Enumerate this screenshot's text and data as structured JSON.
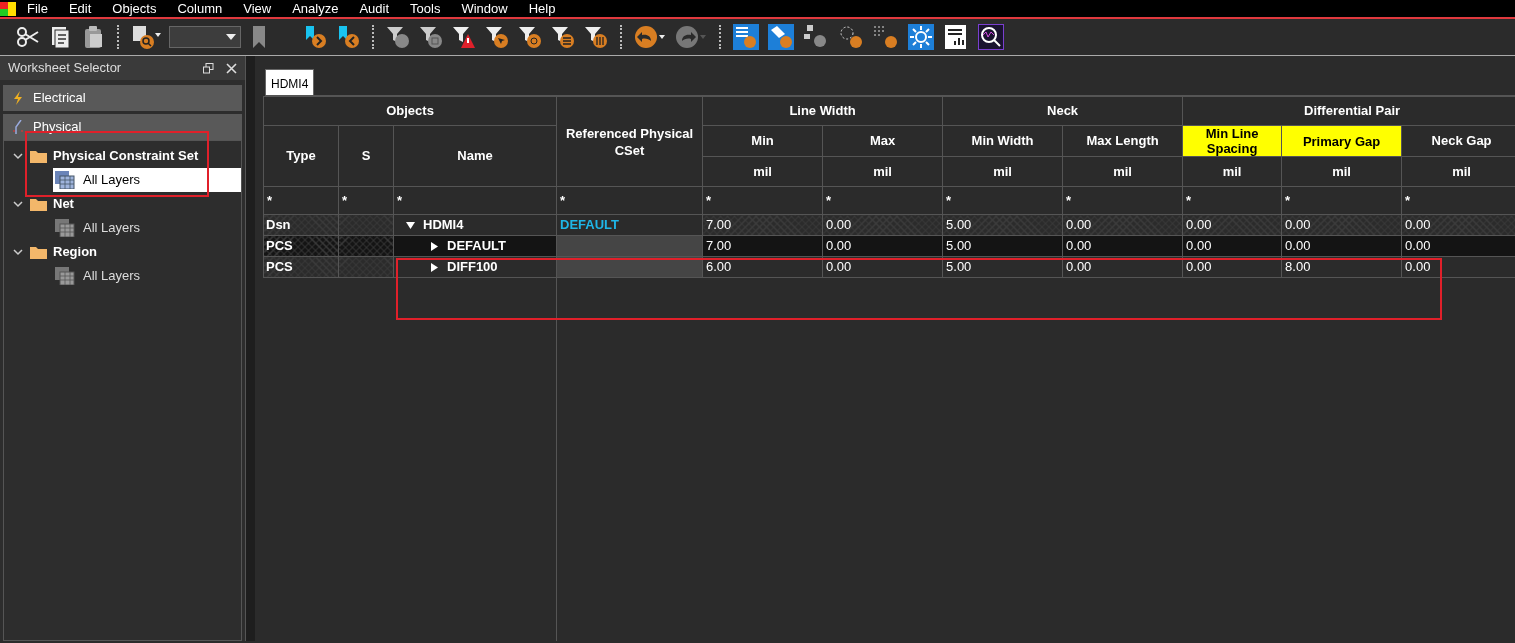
{
  "menu": [
    "File",
    "Edit",
    "Objects",
    "Column",
    "View",
    "Analyze",
    "Audit",
    "Tools",
    "Window",
    "Help"
  ],
  "panel": {
    "title": "Worksheet Selector",
    "sections": [
      {
        "label": "Electrical",
        "kind": "electrical"
      },
      {
        "label": "Physical",
        "kind": "physical"
      }
    ],
    "tree": [
      {
        "label": "Physical Constraint Set",
        "expanded": true,
        "children": [
          {
            "label": "All Layers",
            "selected": true
          }
        ]
      },
      {
        "label": "Net",
        "expanded": true,
        "children": [
          {
            "label": "All Layers",
            "selected": false
          }
        ]
      },
      {
        "label": "Region",
        "expanded": true,
        "children": [
          {
            "label": "All Layers",
            "selected": false
          }
        ]
      }
    ]
  },
  "tabs": [
    {
      "label": "HDMI4",
      "selected": true
    }
  ],
  "table": {
    "objects_group": "Objects",
    "object_columns": [
      "Type",
      "S",
      "Name"
    ],
    "ref_column": "Referenced Physical CSet",
    "groups": [
      {
        "label": "Line Width",
        "columns": [
          {
            "label": "Min",
            "unit": "mil",
            "highlighted": false
          },
          {
            "label": "Max",
            "unit": "mil",
            "highlighted": false
          }
        ]
      },
      {
        "label": "Neck",
        "columns": [
          {
            "label": "Min Width",
            "unit": "mil",
            "highlighted": false
          },
          {
            "label": "Max Length",
            "unit": "mil",
            "highlighted": false
          }
        ]
      },
      {
        "label": "Differential Pair",
        "columns": [
          {
            "label": "Min Line Spacing",
            "unit": "mil",
            "highlighted": true
          },
          {
            "label": "Primary Gap",
            "unit": "mil",
            "highlighted": true
          },
          {
            "label": "Neck Gap",
            "unit": "mil",
            "highlighted": false
          }
        ]
      }
    ],
    "filters": [
      "*",
      "*",
      "*",
      "*",
      "*",
      "*",
      "*",
      "*",
      "*",
      "*",
      "*"
    ],
    "rows": [
      {
        "type": "Dsn",
        "name": "HDMI4",
        "ref": "DEFAULT",
        "expanded": true,
        "selected": false,
        "values": [
          "7.00",
          "0.00",
          "5.00",
          "0.00",
          "0.00",
          "0.00",
          "0.00"
        ],
        "children": [
          {
            "type": "PCS",
            "name": "DEFAULT",
            "expanded": false,
            "selected": true,
            "values": [
              "7.00",
              "0.00",
              "5.00",
              "0.00",
              "0.00",
              "0.00",
              "0.00"
            ]
          },
          {
            "type": "PCS",
            "name": "DIFF100",
            "expanded": false,
            "selected": false,
            "values": [
              "6.00",
              "0.00",
              "5.00",
              "0.00",
              "0.00",
              "8.00",
              "0.00"
            ]
          }
        ]
      }
    ]
  }
}
